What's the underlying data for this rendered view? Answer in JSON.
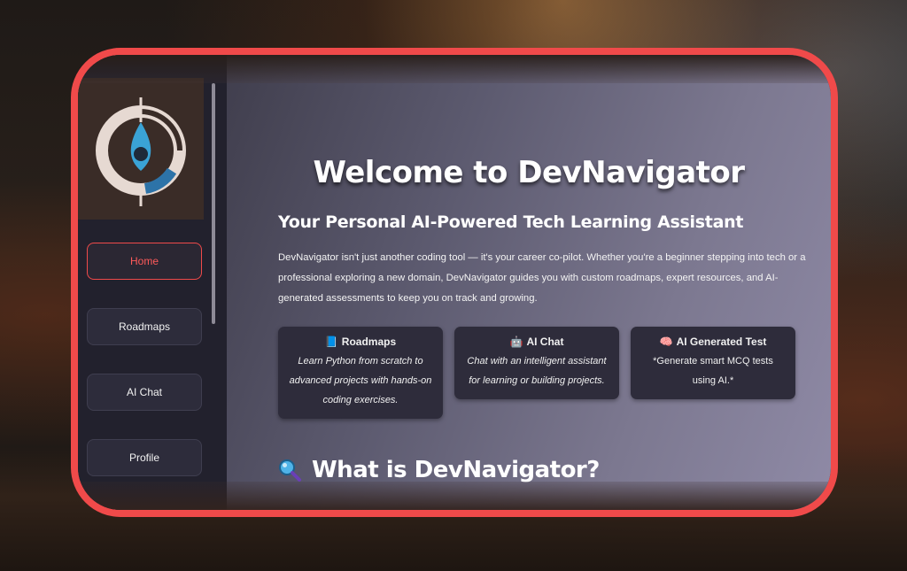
{
  "sidebar": {
    "nav": [
      {
        "label": "Home",
        "active": true
      },
      {
        "label": "Roadmaps",
        "active": false
      },
      {
        "label": "AI Chat",
        "active": false
      },
      {
        "label": "Profile",
        "active": false
      }
    ]
  },
  "main": {
    "title": "Welcome to DevNavigator",
    "subtitle": "Your Personal AI-Powered Tech Learning Assistant",
    "intro": "DevNavigator isn't just another coding tool — it's your career co-pilot. Whether you're a beginner stepping into tech or a professional exploring a new domain, DevNavigator guides you with custom roadmaps, expert resources, and AI-generated assessments to keep you on track and growing.",
    "cards": [
      {
        "icon": "📘",
        "icon_name": "book-icon",
        "title": "Roadmaps",
        "body": "Learn Python from scratch to advanced projects with hands-on coding exercises."
      },
      {
        "icon": "🤖",
        "icon_name": "robot-icon",
        "title": "AI Chat",
        "body": "Chat with an intelligent assistant for learning or building projects."
      },
      {
        "icon": "🧠",
        "icon_name": "brain-icon",
        "title": "AI Generated Test",
        "body": "*Generate smart MCQ tests using AI.*"
      }
    ],
    "section_title": "What is DevNavigator?",
    "section_icon": "magnifier-icon"
  },
  "colors": {
    "accent": "#f04a4a",
    "sidebar": "#22212d",
    "card": "#2e2c3b"
  }
}
